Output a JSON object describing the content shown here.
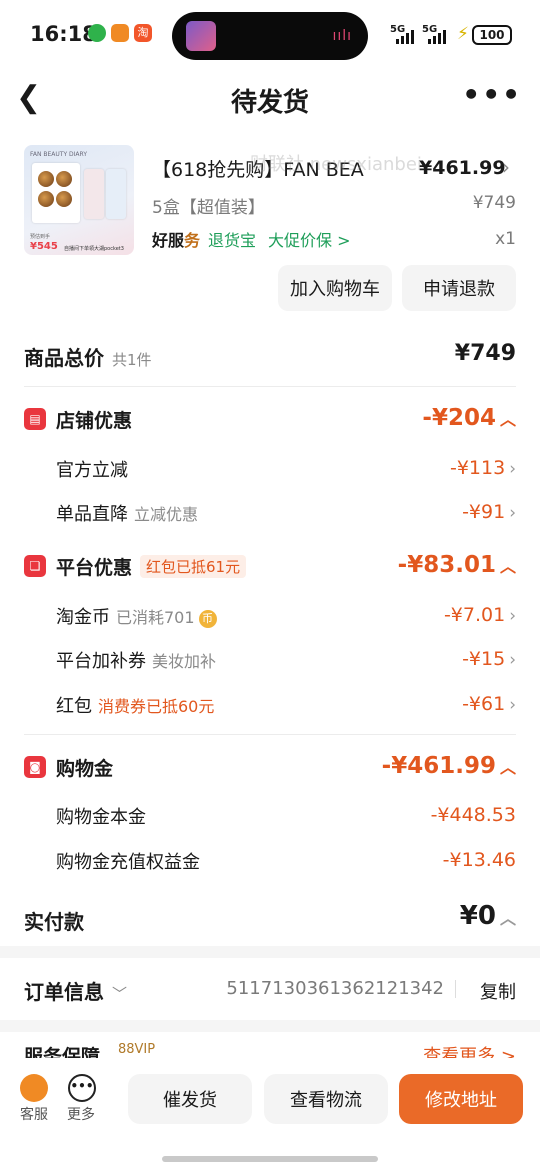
{
  "status_bar": {
    "time": "16:18",
    "network_1": "5G",
    "network_2": "5G",
    "battery": "100",
    "wave": "ıılı"
  },
  "nav": {
    "back_icon": "chevron-left",
    "title": "待发货",
    "more_icon": "ellipsis"
  },
  "product": {
    "title": "【618抢先购】FAN BEA",
    "price": "¥461.99",
    "spec": "5盒【超值装】",
    "original_price": "¥749",
    "good_service_a": "好服",
    "good_service_b": "务",
    "return_tag": "退货宝",
    "price_protect": "大促价保 >",
    "quantity": "x1",
    "thumb": {
      "brand": "FAN BEAUTY DIARY",
      "price": "¥545",
      "price_label": "预估到手",
      "footer": "自播间下单領大湖pocket3"
    }
  },
  "buttons": {
    "add_to_cart": "加入购物车",
    "request_refund": "申请退款"
  },
  "summary": {
    "total_label": "商品总价",
    "total_count": "共1件",
    "total_value": "¥749"
  },
  "store_discount": {
    "title": "店铺优惠",
    "amount": "-¥204",
    "items": [
      {
        "label": "官方立减",
        "hint": "",
        "value": "-¥113"
      },
      {
        "label": "单品直降",
        "hint": "立减优惠",
        "value": "-¥91"
      }
    ]
  },
  "platform_discount": {
    "title": "平台优惠",
    "chip": "红包已抵61元",
    "amount": "-¥83.01",
    "items": [
      {
        "label": "淘金币",
        "hint": "已消耗701",
        "value": "-¥7.01"
      },
      {
        "label": "平台加补券",
        "hint": "美妆加补",
        "value": "-¥15"
      },
      {
        "label": "红包",
        "hint": "消费券已抵60元",
        "value": "-¥61"
      }
    ]
  },
  "shopping_credit": {
    "title": "购物金",
    "amount": "-¥461.99",
    "items": [
      {
        "label": "购物金本金",
        "value": "-¥448.53"
      },
      {
        "label": "购物金充值权益金",
        "value": "-¥13.46"
      }
    ]
  },
  "paid": {
    "label": "实付款",
    "value": "¥0"
  },
  "order_info": {
    "label": "订单信息",
    "order_id": "5117130361362121342",
    "copy": "复制"
  },
  "service": {
    "label": "服务保障",
    "badge": "88VIP",
    "more": "查看更多 >"
  },
  "bottom_bar": {
    "service_label": "客服",
    "more_label": "更多",
    "urge_ship": "催发货",
    "view_logistics": "查看物流",
    "change_address": "修改地址"
  },
  "watermark": "财联社 newsxianbei",
  "colors": {
    "accent_orange": "#e2571e",
    "red_icon": "#e9363e",
    "green": "#1e9e59",
    "primary_button": "#ea6a28"
  }
}
